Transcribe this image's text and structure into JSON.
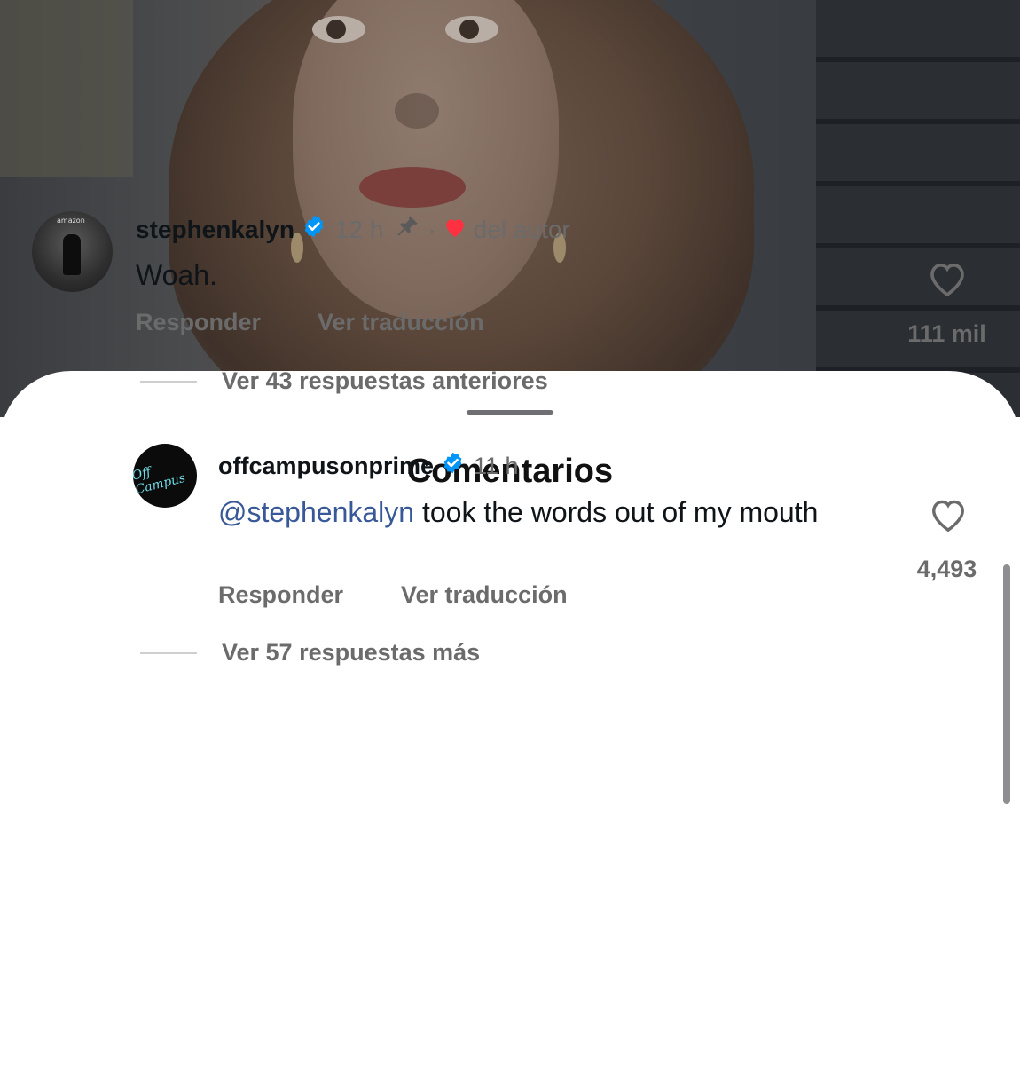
{
  "sheet": {
    "title": "Comentarios"
  },
  "comments": [
    {
      "username": "stephenkalyn",
      "time": "12 h",
      "separator": "·",
      "author_like": "del autor",
      "avatar_text": "amazon",
      "text": "Woah.",
      "reply_label": "Responder",
      "translate_label": "Ver traducción",
      "likes": "111 mil",
      "more_replies": "Ver 43 respuestas anteriores"
    },
    {
      "username": "offcampusonprime",
      "time": "11 h",
      "avatar_text": "Off Campus",
      "mention": "@stephenkalyn",
      "text": " took the words out of my mouth",
      "reply_label": "Responder",
      "translate_label": "Ver traducción",
      "likes": "4,493",
      "more_replies": "Ver 57 respuestas más"
    }
  ],
  "icons": {
    "verified": "verified-badge-icon",
    "pin": "pin-icon",
    "author_heart": "red-heart-icon",
    "like": "heart-outline-icon"
  },
  "colors": {
    "verified": "#0095f6",
    "heart_red": "#ff3040",
    "mention": "#385898",
    "secondary_text": "#6b6b6b"
  }
}
